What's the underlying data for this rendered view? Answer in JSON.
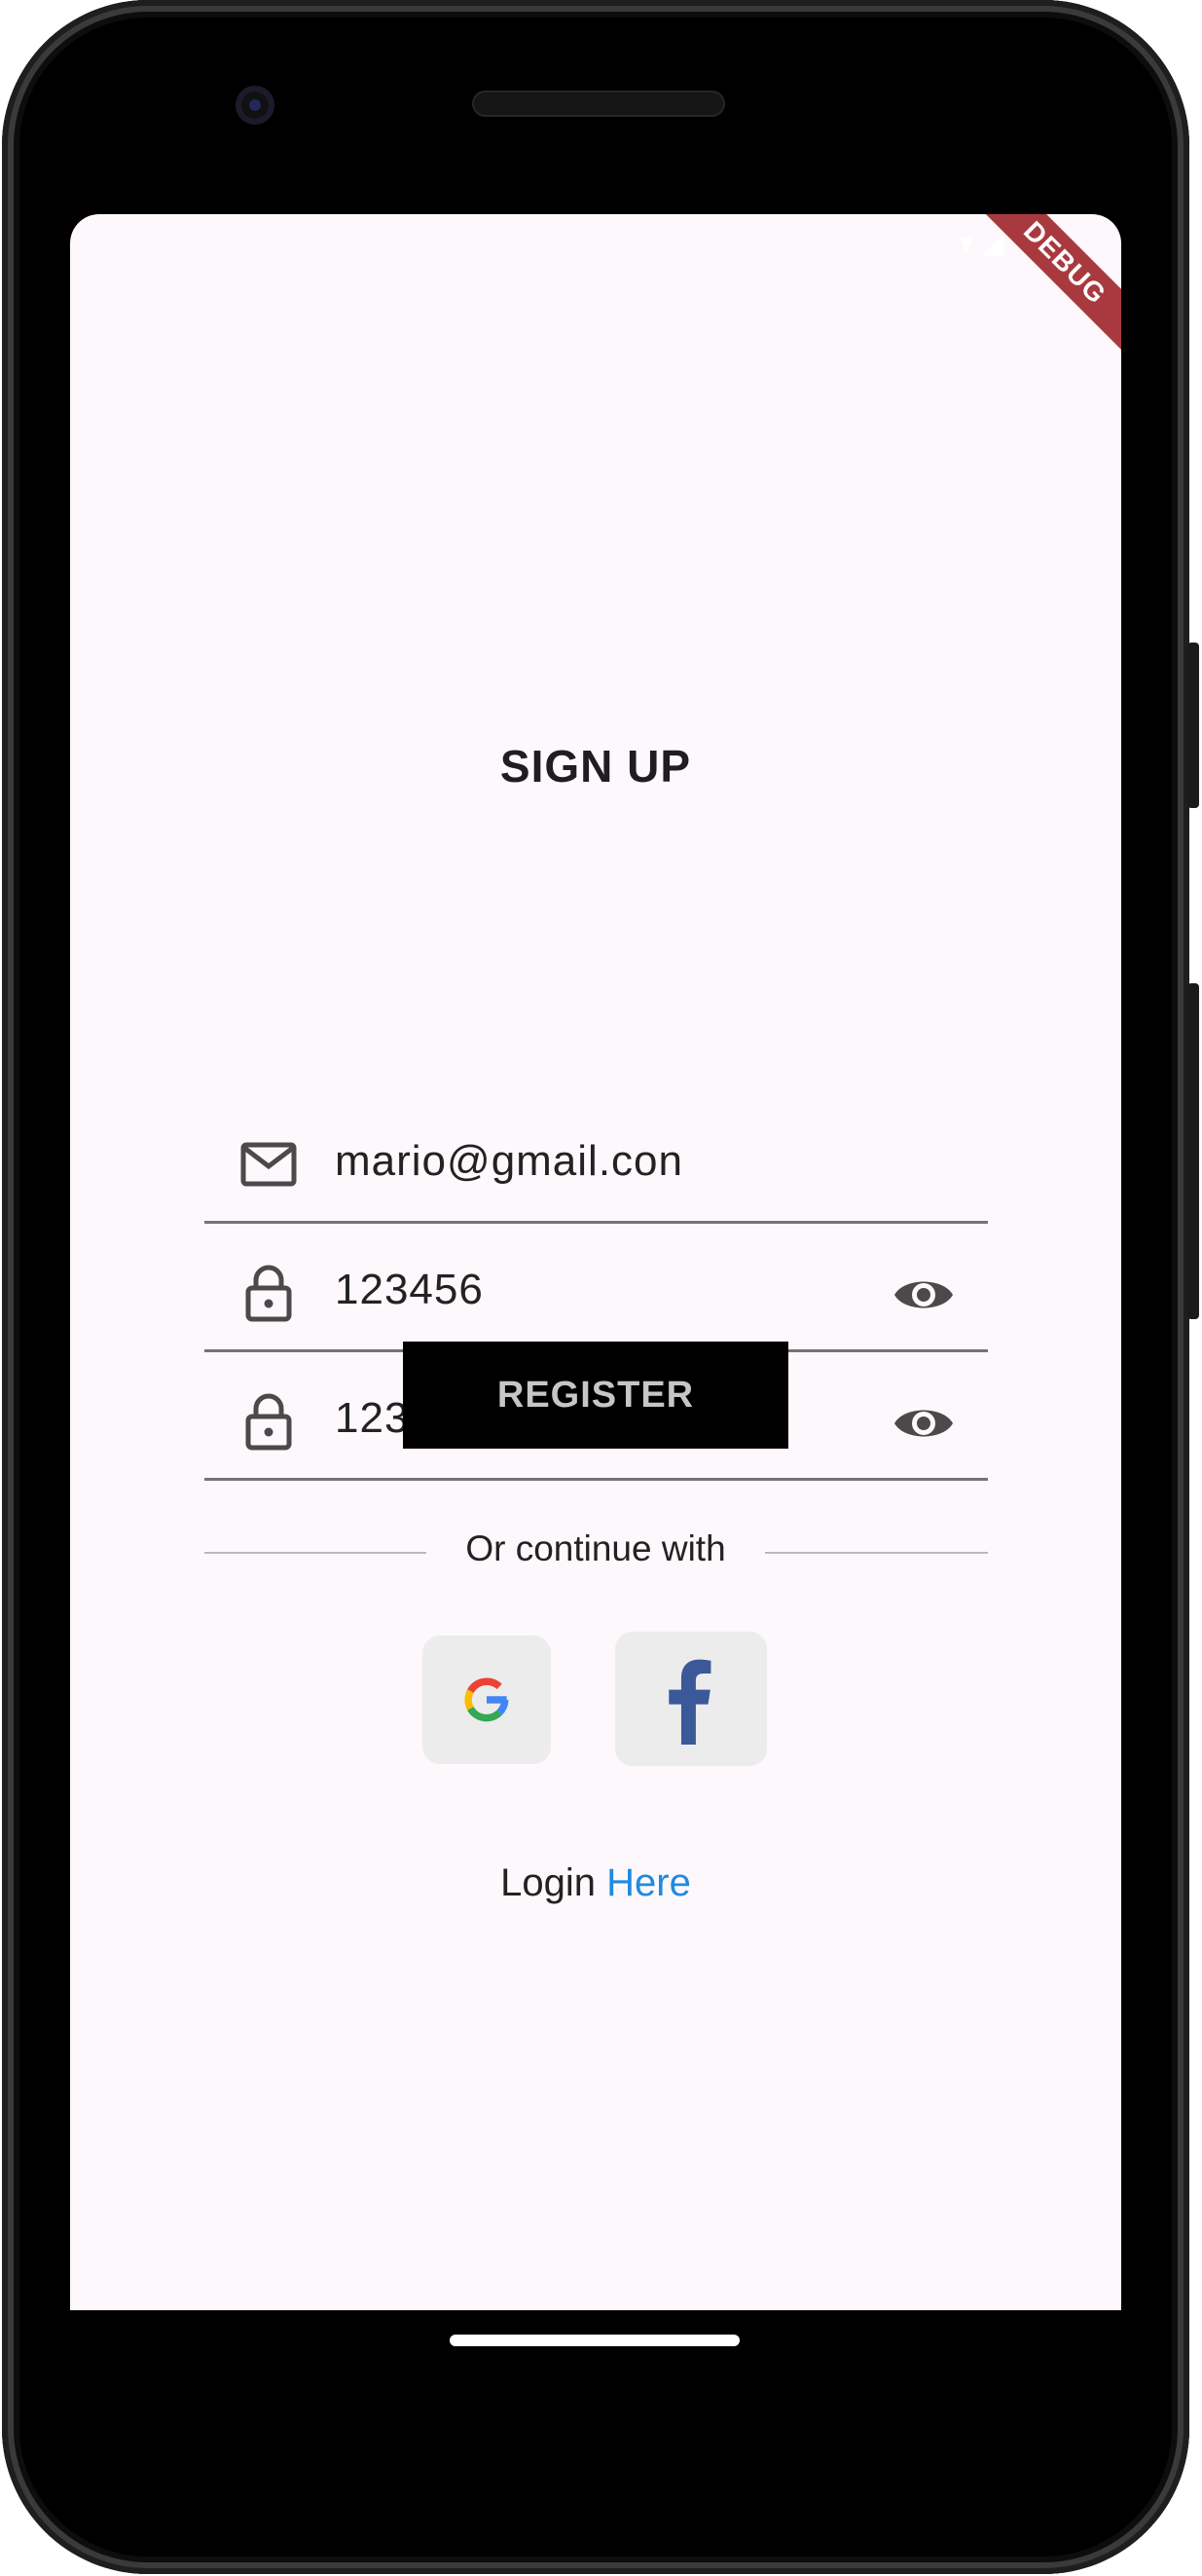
{
  "screen": {
    "title": "SIGN UP",
    "debug_banner": "DEBUG",
    "email_field": {
      "value": "mario@gmail.con"
    },
    "password_field": {
      "value": "123456"
    },
    "confirm_password_field": {
      "value": "123456"
    },
    "register_button": {
      "label": "REGISTER"
    },
    "divider_text": "Or continue with",
    "social": {
      "google_icon": "google-icon",
      "facebook_icon": "facebook-icon"
    },
    "login_prefix": "Login",
    "login_link": "Here"
  },
  "colors": {
    "background": "#fdf8fb",
    "button": "#000000",
    "button_text": "#c6c6c6",
    "link": "#1f8ae0",
    "debug": "#a83a3f",
    "facebook": "#3b5998"
  }
}
